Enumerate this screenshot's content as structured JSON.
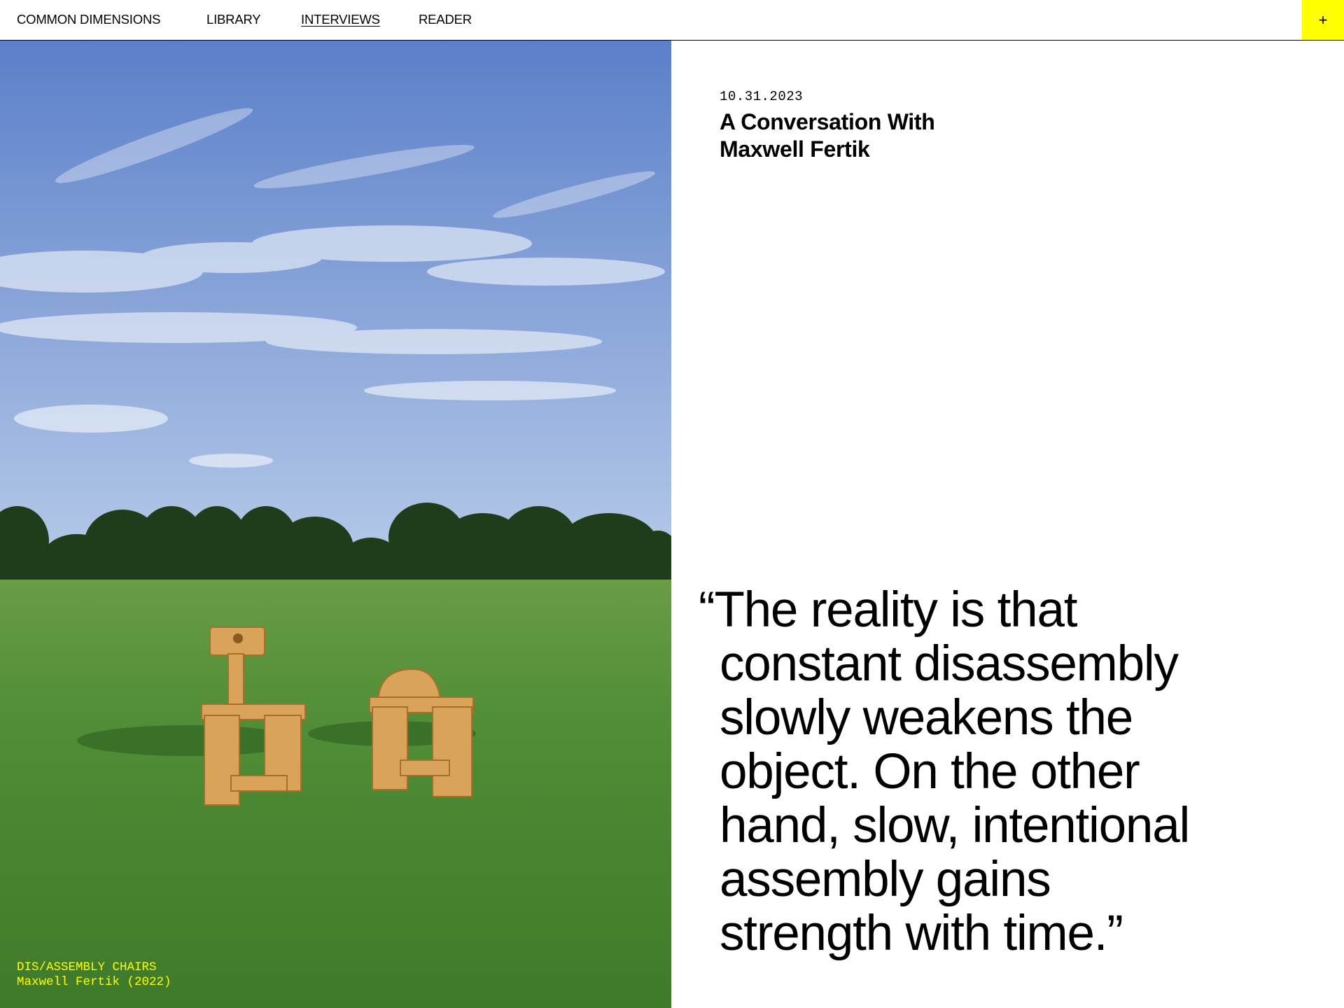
{
  "nav": {
    "items": [
      {
        "label": "COMMON DIMENSIONS",
        "active": false
      },
      {
        "label": "LIBRARY",
        "active": false
      },
      {
        "label": "INTERVIEWS",
        "active": true
      },
      {
        "label": "READER",
        "active": false
      }
    ],
    "plus_label": "+"
  },
  "hero": {
    "caption_title": "DIS/ASSEMBLY CHAIRS",
    "caption_credit": "Maxwell Fertik (2022)"
  },
  "article": {
    "date": "10.31.2023",
    "title_line1": "A Conversation With",
    "title_line2": "Maxwell Fertik",
    "quote_lines": [
      "“The reality is that",
      "constant disassembly",
      "slowly weakens the",
      "object. On the other",
      "hand, slow, intentional",
      "assembly gains",
      "strength with time.”"
    ]
  },
  "colors": {
    "accent": "#ffff00",
    "caption_text": "#ffff00",
    "sky_top": "#5b7fc9",
    "sky_bottom": "#b9cdea",
    "grass": "#4f8d36",
    "trees": "#1f3d1a",
    "chair_wood": "#d9a35a"
  },
  "icons": {
    "plus": "plus-icon"
  }
}
